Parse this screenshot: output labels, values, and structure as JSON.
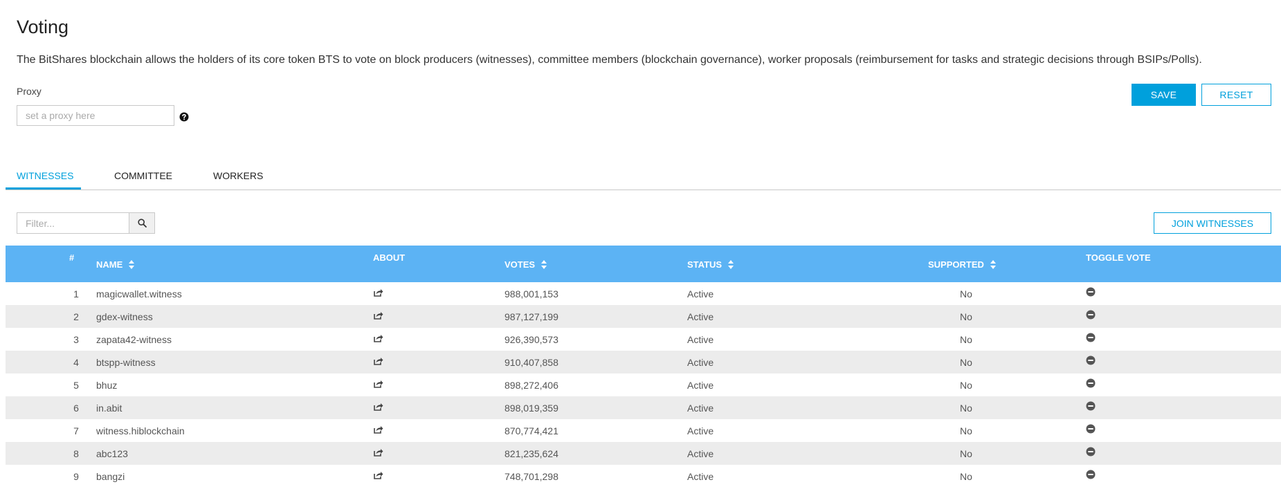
{
  "page": {
    "title": "Voting",
    "description": "The BitShares blockchain allows the holders of its core token BTS to vote on block producers (witnesses), committee members (blockchain governance), worker proposals (reimbursement for tasks and strategic decisions through BSIPs/Polls)."
  },
  "proxy": {
    "label": "Proxy",
    "placeholder": "set a proxy here",
    "value": "",
    "help_icon": "question-circle-icon"
  },
  "actions": {
    "save_label": "SAVE",
    "reset_label": "RESET"
  },
  "tabs": [
    {
      "label": "WITNESSES",
      "active": true
    },
    {
      "label": "COMMITTEE",
      "active": false
    },
    {
      "label": "WORKERS",
      "active": false
    }
  ],
  "filter": {
    "placeholder": "Filter...",
    "value": "",
    "icon": "search-icon"
  },
  "join_label": "JOIN WITNESSES",
  "colors": {
    "accent": "#00a0dc",
    "header_bg": "#5cb3f4",
    "row_alt": "#ececec"
  },
  "table": {
    "columns": {
      "num": "#",
      "name": "NAME",
      "about": "ABOUT",
      "votes": "VOTES",
      "status": "STATUS",
      "supported": "SUPPORTED",
      "toggle": "TOGGLE VOTE"
    },
    "rows": [
      {
        "num": "1",
        "name": "magicwallet.witness",
        "votes": "988,001,153",
        "status": "Active",
        "supported": "No"
      },
      {
        "num": "2",
        "name": "gdex-witness",
        "votes": "987,127,199",
        "status": "Active",
        "supported": "No"
      },
      {
        "num": "3",
        "name": "zapata42-witness",
        "votes": "926,390,573",
        "status": "Active",
        "supported": "No"
      },
      {
        "num": "4",
        "name": "btspp-witness",
        "votes": "910,407,858",
        "status": "Active",
        "supported": "No"
      },
      {
        "num": "5",
        "name": "bhuz",
        "votes": "898,272,406",
        "status": "Active",
        "supported": "No"
      },
      {
        "num": "6",
        "name": "in.abit",
        "votes": "898,019,359",
        "status": "Active",
        "supported": "No"
      },
      {
        "num": "7",
        "name": "witness.hiblockchain",
        "votes": "870,774,421",
        "status": "Active",
        "supported": "No"
      },
      {
        "num": "8",
        "name": "abc123",
        "votes": "821,235,624",
        "status": "Active",
        "supported": "No"
      },
      {
        "num": "9",
        "name": "bangzi",
        "votes": "748,701,298",
        "status": "Active",
        "supported": "No"
      }
    ]
  }
}
